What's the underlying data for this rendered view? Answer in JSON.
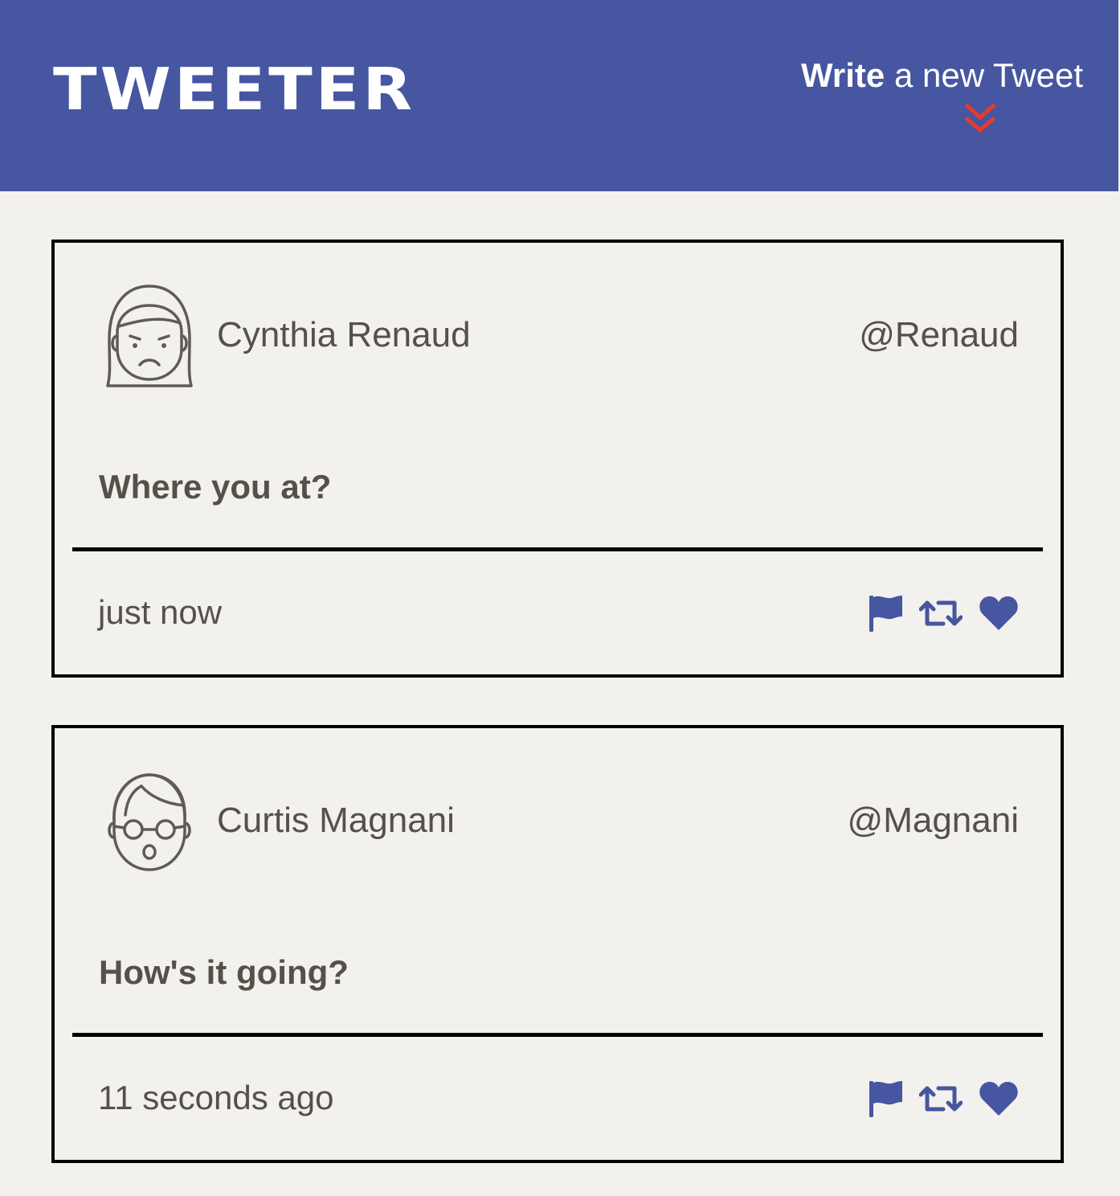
{
  "header": {
    "brand": "TWEETER",
    "compose": {
      "bold": "Write",
      "rest": " a new Tweet",
      "icon": "double-chevron-down-icon",
      "icon_color": "#e53b2c"
    }
  },
  "colors": {
    "nav_bg": "#4656a0",
    "page_bg": "#f2f1ed",
    "text": "#545149",
    "accent": "#4656a0"
  },
  "tweets": [
    {
      "user": {
        "name": "Cynthia Renaud",
        "handle": "@Renaud",
        "avatar": "woman-frowning-avatar-icon"
      },
      "content": "Where you at?",
      "timestamp": "just now",
      "actions": [
        "flag-icon",
        "retweet-icon",
        "heart-icon"
      ]
    },
    {
      "user": {
        "name": "Curtis Magnani",
        "handle": "@Magnani",
        "avatar": "man-with-glasses-avatar-icon"
      },
      "content": "How's it going?",
      "timestamp": "11 seconds ago",
      "actions": [
        "flag-icon",
        "retweet-icon",
        "heart-icon"
      ]
    }
  ]
}
